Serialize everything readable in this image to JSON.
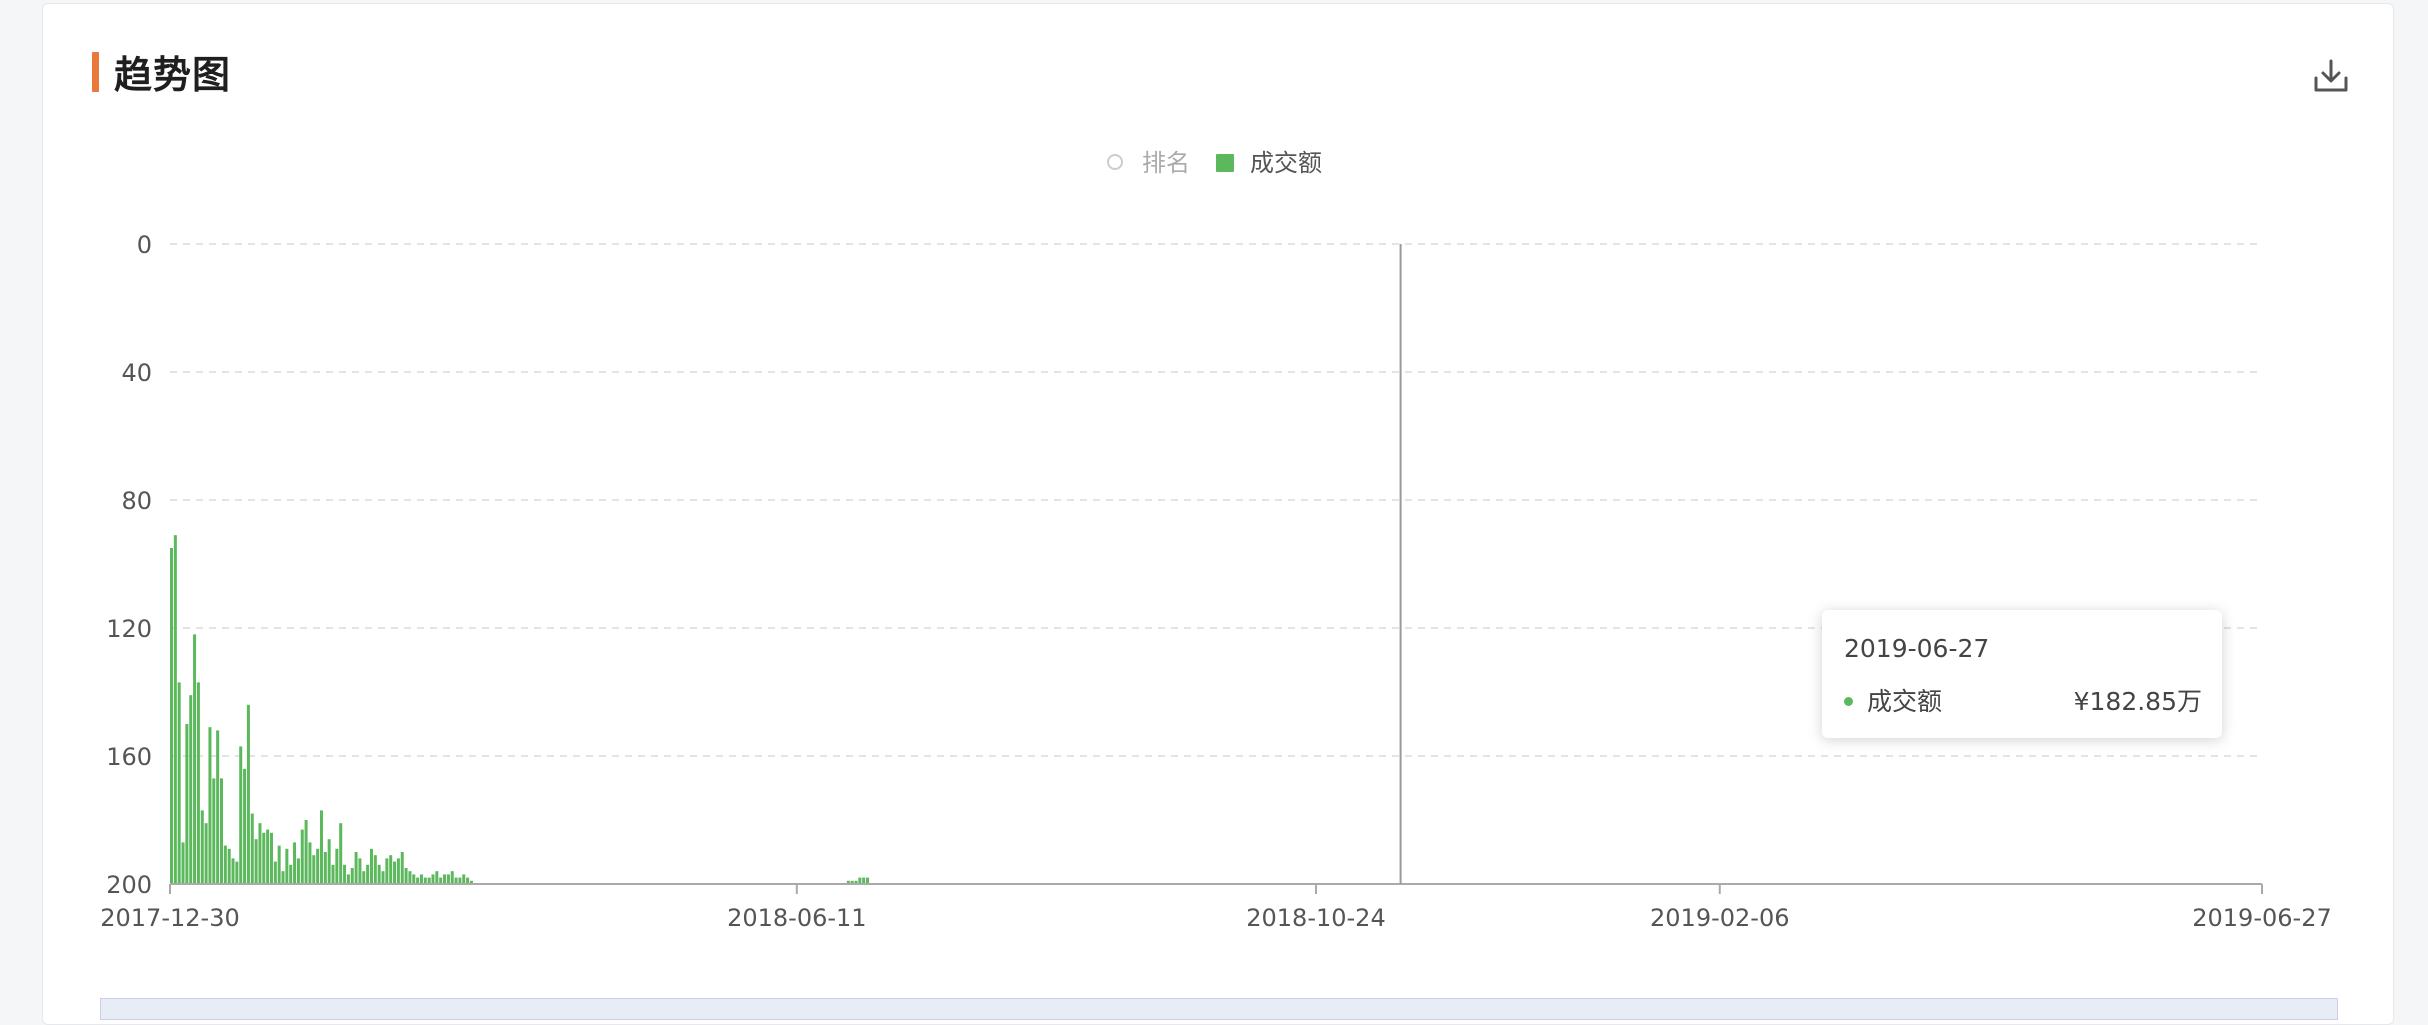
{
  "header": {
    "title": "趋势图",
    "download_icon": "download-icon"
  },
  "legend": [
    {
      "name": "排名",
      "active": false
    },
    {
      "name": "成交额",
      "active": true,
      "color": "#5cb85c"
    }
  ],
  "tooltip": {
    "date": "2019-06-27",
    "series_name": "成交额",
    "value": "¥182.85万"
  },
  "chart_data": {
    "type": "bar",
    "title": "",
    "ylabel": "",
    "xlabel": "",
    "y_inverted": true,
    "yticks": [
      0,
      40,
      80,
      120,
      160,
      200
    ],
    "ylim": [
      0,
      200
    ],
    "xlim": [
      "2017-12-30",
      "2019-06-27"
    ],
    "xticks": [
      "2017-12-30",
      "2018-06-11",
      "2018-10-24",
      "2019-02-06",
      "2019-06-27"
    ],
    "grid": true,
    "crosshair_date": "2018-11-15",
    "series": [
      {
        "name": "成交额",
        "color": "#5cb85c",
        "points": [
          [
            "2017-12-30",
            95
          ],
          [
            "2017-12-31",
            91
          ],
          [
            "2018-01-01",
            137
          ],
          [
            "2018-01-02",
            187
          ],
          [
            "2018-01-03",
            150
          ],
          [
            "2018-01-04",
            141
          ],
          [
            "2018-01-05",
            122
          ],
          [
            "2018-01-06",
            137
          ],
          [
            "2018-01-07",
            177
          ],
          [
            "2018-01-08",
            181
          ],
          [
            "2018-01-09",
            151
          ],
          [
            "2018-01-10",
            167
          ],
          [
            "2018-01-11",
            152
          ],
          [
            "2018-01-12",
            167
          ],
          [
            "2018-01-13",
            188
          ],
          [
            "2018-01-14",
            189
          ],
          [
            "2018-01-15",
            192
          ],
          [
            "2018-01-16",
            193
          ],
          [
            "2018-01-17",
            157
          ],
          [
            "2018-01-18",
            164
          ],
          [
            "2018-01-19",
            144
          ],
          [
            "2018-01-20",
            178
          ],
          [
            "2018-01-21",
            186
          ],
          [
            "2018-01-22",
            181
          ],
          [
            "2018-01-23",
            184
          ],
          [
            "2018-01-24",
            183
          ],
          [
            "2018-01-25",
            184
          ],
          [
            "2018-01-26",
            193
          ],
          [
            "2018-01-27",
            188
          ],
          [
            "2018-01-28",
            196
          ],
          [
            "2018-01-29",
            189
          ],
          [
            "2018-01-30",
            194
          ],
          [
            "2018-01-31",
            187
          ],
          [
            "2018-02-01",
            192
          ],
          [
            "2018-02-02",
            183
          ],
          [
            "2018-02-03",
            180
          ],
          [
            "2018-02-04",
            187
          ],
          [
            "2018-02-05",
            191
          ],
          [
            "2018-02-06",
            189
          ],
          [
            "2018-02-07",
            177
          ],
          [
            "2018-02-08",
            190
          ],
          [
            "2018-02-09",
            186
          ],
          [
            "2018-02-10",
            194
          ],
          [
            "2018-02-11",
            189
          ],
          [
            "2018-02-12",
            181
          ],
          [
            "2018-02-13",
            194
          ],
          [
            "2018-02-14",
            197
          ],
          [
            "2018-02-15",
            195
          ],
          [
            "2018-02-16",
            190
          ],
          [
            "2018-02-17",
            192
          ],
          [
            "2018-02-18",
            196
          ],
          [
            "2018-02-19",
            194
          ],
          [
            "2018-02-20",
            189
          ],
          [
            "2018-02-21",
            191
          ],
          [
            "2018-02-22",
            194
          ],
          [
            "2018-02-23",
            196
          ],
          [
            "2018-02-24",
            192
          ],
          [
            "2018-02-25",
            191
          ],
          [
            "2018-02-26",
            193
          ],
          [
            "2018-02-27",
            192
          ],
          [
            "2018-02-28",
            190
          ],
          [
            "2018-03-01",
            195
          ],
          [
            "2018-03-02",
            196
          ],
          [
            "2018-03-03",
            197
          ],
          [
            "2018-03-04",
            198
          ],
          [
            "2018-03-05",
            197
          ],
          [
            "2018-03-06",
            198
          ],
          [
            "2018-03-07",
            198
          ],
          [
            "2018-03-08",
            197
          ],
          [
            "2018-03-09",
            196
          ],
          [
            "2018-03-10",
            198
          ],
          [
            "2018-03-11",
            197
          ],
          [
            "2018-03-12",
            197
          ],
          [
            "2018-03-13",
            196
          ],
          [
            "2018-03-14",
            198
          ],
          [
            "2018-03-15",
            198
          ],
          [
            "2018-03-16",
            197
          ],
          [
            "2018-03-17",
            198
          ],
          [
            "2018-03-18",
            199
          ],
          [
            "2018-06-24",
            199
          ],
          [
            "2018-06-25",
            199
          ],
          [
            "2018-06-26",
            199
          ],
          [
            "2018-06-27",
            198
          ],
          [
            "2018-06-28",
            198
          ],
          [
            "2018-06-29",
            198
          ]
        ]
      }
    ]
  }
}
